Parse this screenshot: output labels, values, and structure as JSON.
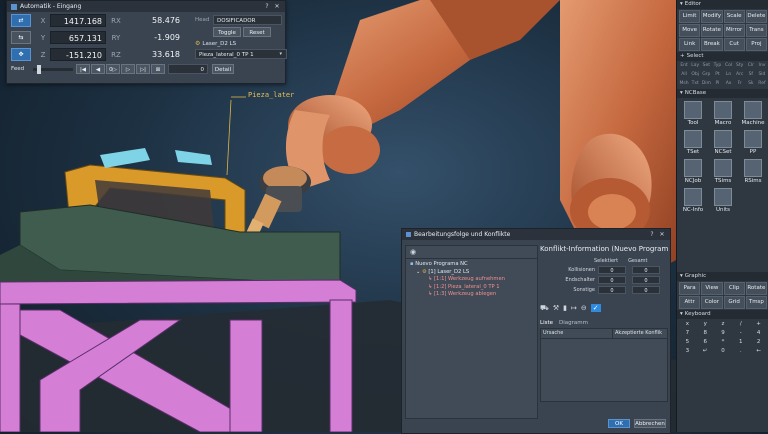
{
  "automatik": {
    "title": "Automatik - Eingang",
    "help": "?",
    "close": "✕",
    "axes": [
      {
        "label": "X",
        "value": "1417.168",
        "rlabel": "RX",
        "rvalue": "58.476"
      },
      {
        "label": "Y",
        "value": "657.131",
        "rlabel": "RY",
        "rvalue": "-1.909"
      },
      {
        "label": "Z",
        "value": "-151.210",
        "rlabel": "RZ",
        "rvalue": "33.618"
      }
    ],
    "feed_label": "Feed",
    "head_label": "Head",
    "head_value": "DOSIFICADOR",
    "toggle_label": "Toggle",
    "reset_label": "Reset",
    "tool_label": "Laser_D2 LS",
    "program_value": "Pieza_lateral_0 TP 1",
    "detail_label": "Detail",
    "transport": [
      "|◀",
      "◀",
      "0▷",
      "▷",
      "▷|",
      "⊠",
      "0"
    ]
  },
  "viewport": {
    "part_label": "Pieza_later"
  },
  "dock": {
    "editor": {
      "title": "Editor",
      "buttons": [
        "Limit",
        "Modify",
        "Scale",
        "Delete",
        "Move",
        "Rotate",
        "Mirror",
        "Trans",
        "Link",
        "Break",
        "Cut",
        "Proj"
      ]
    },
    "select": {
      "title": "Select",
      "items": [
        "Ent",
        "Lay",
        "Set",
        "Typ",
        "Col",
        "Sty",
        "Clr",
        "Inv",
        "All",
        "Obj",
        "Grp",
        "Pt",
        "Ln",
        "Arc",
        "Sf",
        "Sld",
        "Msh",
        "Txt",
        "Dim",
        "Pl",
        "Ax",
        "Fr",
        "Sk",
        "Ref"
      ]
    },
    "ncbase": {
      "title": "NCBase",
      "tiles": [
        {
          "label": "Tool",
          "icon": "tool-icon"
        },
        {
          "label": "Macro",
          "icon": "macro-icon"
        },
        {
          "label": "Machine",
          "icon": "machine-icon"
        },
        {
          "label": "TSet",
          "icon": "tset-icon"
        },
        {
          "label": "NCSet",
          "icon": "ncset-icon"
        },
        {
          "label": "PP",
          "icon": "pp-icon"
        },
        {
          "label": "NCJob",
          "icon": "ncjob-icon"
        },
        {
          "label": "TSims",
          "icon": "tsims-icon"
        },
        {
          "label": "RSims",
          "icon": "rsims-icon"
        },
        {
          "label": "NC-Info",
          "icon": "ncinfo-icon"
        },
        {
          "label": "Units",
          "icon": "units-icon"
        }
      ]
    },
    "graphic": {
      "title": "Graphic",
      "buttons": [
        "Para",
        "View",
        "Clip",
        "Rotate",
        "Attr",
        "Color",
        "Grid",
        "Tmsp"
      ]
    },
    "keyboard": {
      "title": "Keyboard",
      "keys": [
        "x",
        "y",
        "z",
        "/",
        "+",
        "7",
        "8",
        "9",
        "-",
        "4",
        "5",
        "6",
        "*",
        "1",
        "2",
        "3",
        "↵",
        "0",
        ".",
        "←"
      ]
    }
  },
  "konflikt": {
    "title": "Bearbeitungsfolge und Konflikte",
    "help": "?",
    "close": "✕",
    "tree": [
      {
        "text": "Nuevo Programa NC",
        "indent": 0,
        "red": false
      },
      {
        "text": "[1] Laser_D2 LS",
        "indent": 1,
        "red": false
      },
      {
        "text": "[1:1] Werkzeug aufnehmen",
        "indent": 2,
        "red": true
      },
      {
        "text": "[1:2] Pieza_lateral_0 TP 1",
        "indent": 2,
        "red": true
      },
      {
        "text": "[1:3] Werkzeug ablegen",
        "indent": 2,
        "red": true
      }
    ],
    "info_title": "Konflikt-Information (Nuevo Programa N",
    "col_selected": "Selektiert",
    "col_total": "Gesamt",
    "rows": [
      {
        "label": "Kollisionen",
        "sel": "0",
        "tot": "0"
      },
      {
        "label": "Endschalter",
        "sel": "0",
        "tot": "0"
      },
      {
        "label": "Sonstige",
        "sel": "0",
        "tot": "0"
      }
    ],
    "tab_list": "Liste",
    "tab_diagram": "Diagramm",
    "col_cause": "Ursache",
    "col_accepted": "Akzeptierte Konflik",
    "ok_label": "OK",
    "cancel_label": "Abbrechen"
  },
  "colors": {
    "panel": "#3a4350",
    "titlebar": "#2b323b",
    "robot": "#c87048",
    "part_frame": "#d99a2a",
    "table": "#d47ed6",
    "accent": "#2f6fb0"
  }
}
